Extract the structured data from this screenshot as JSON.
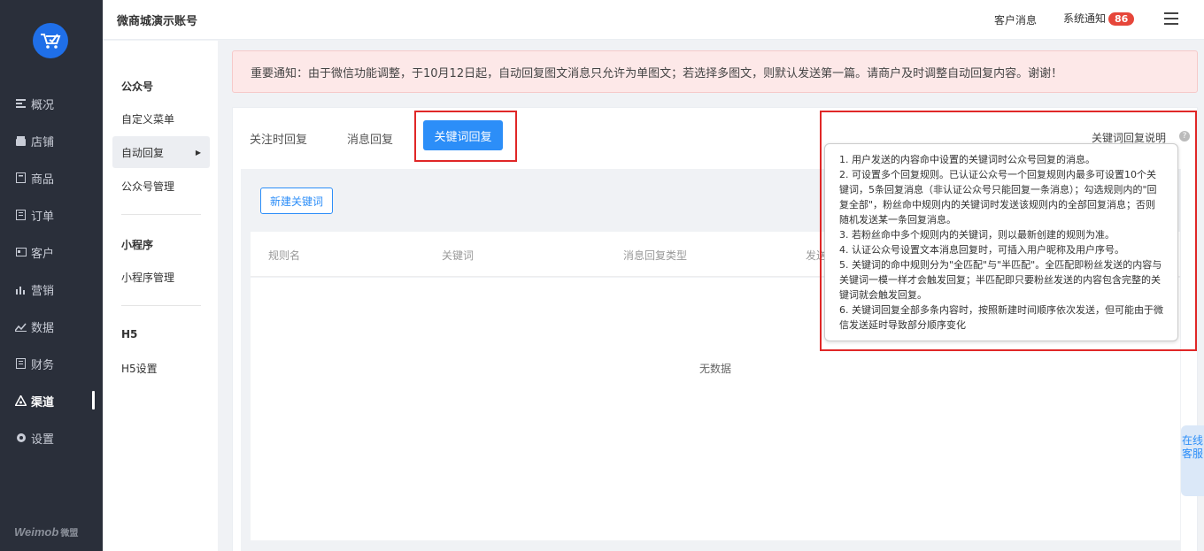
{
  "sidebar": {
    "items": [
      {
        "label": "概况",
        "icon": "overview-icon"
      },
      {
        "label": "店铺",
        "icon": "store-icon"
      },
      {
        "label": "商品",
        "icon": "goods-icon"
      },
      {
        "label": "订单",
        "icon": "order-icon"
      },
      {
        "label": "客户",
        "icon": "customer-icon"
      },
      {
        "label": "营销",
        "icon": "marketing-icon"
      },
      {
        "label": "数据",
        "icon": "data-icon"
      },
      {
        "label": "财务",
        "icon": "finance-icon"
      },
      {
        "label": "渠道",
        "icon": "channel-icon"
      },
      {
        "label": "设置",
        "icon": "settings-icon"
      }
    ],
    "active": "渠道",
    "brand": "Weimob",
    "brand_sub": "微盟"
  },
  "header": {
    "account": "微商城演示账号",
    "customer_msg": "客户消息",
    "system_notice": "系统通知",
    "notice_count": "86"
  },
  "subnav": {
    "groups": [
      {
        "title": "公众号",
        "items": [
          "自定义菜单",
          "自动回复",
          "公众号管理"
        ]
      },
      {
        "title": "小程序",
        "items": [
          "小程序管理"
        ]
      },
      {
        "title": "H5",
        "items": [
          "H5设置"
        ]
      }
    ]
  },
  "notice": "重要通知：由于微信功能调整，于10月12日起，自动回复图文消息只允许为单图文；若选择多图文，则默认发送第一篇。请商户及时调整自动回复内容。谢谢！",
  "tabs": [
    "关注时回复",
    "消息回复",
    "关键词回复"
  ],
  "active_tab": "关键词回复",
  "help_link": "关键词回复说明",
  "new_keyword_button": "新建关键词",
  "table": {
    "headers": [
      "规则名",
      "关键词",
      "消息回复类型",
      "发送"
    ],
    "empty": "无数据"
  },
  "tooltip": [
    "1. 用户发送的内容命中设置的关键词时公众号回复的消息。",
    "2. 可设置多个回复规则。已认证公众号一个回复规则内最多可设置10个关键词，5条回复消息（非认证公众号只能回复一条消息）；勾选规则内的\"回复全部\"，粉丝命中规则内的关键词时发送该规则内的全部回复消息；否则随机发送某一条回复消息。",
    "3. 若粉丝命中多个规则内的关键词，则以最新创建的规则为准。",
    "4. 认证公众号设置文本消息回复时，可插入用户昵称及用户序号。",
    "5. 关键词的命中规则分为\"全匹配\"与\"半匹配\"。全匹配即粉丝发送的内容与关键词一模一样才会触发回复；半匹配即只要粉丝发送的内容包含完整的关键词就会触发回复。",
    "6. 关键词回复全部多条内容时，按照新建时间顺序依次发送，但可能由于微信发送延时导致部分顺序变化"
  ],
  "service": "在线客服",
  "colors": {
    "accent": "#2c8ef8",
    "highlight": "#e02727",
    "sidebar": "#2a2f3a",
    "badge": "#e6463a"
  }
}
